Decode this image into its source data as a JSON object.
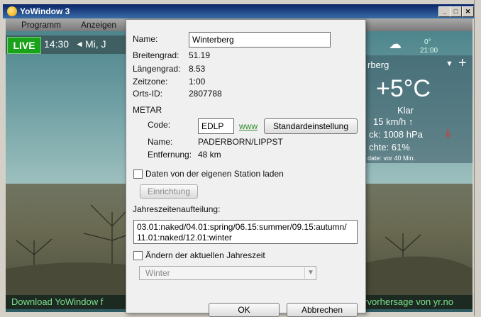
{
  "window": {
    "title": "YoWindow 3",
    "min_label": "_",
    "max_label": "□",
    "close_label": "✕"
  },
  "menu": {
    "items": [
      "Programm",
      "Anzeigen"
    ]
  },
  "app": {
    "live_label": "LIVE",
    "time": "14:30",
    "nav_prev": "◄",
    "date_partial": "Mi, J",
    "forecast_time": "21:00",
    "forecast_temp": "0°",
    "location_partial": "rberg",
    "temperature": "+5°C",
    "condition": "Klar",
    "wind": "15 km/h ↑",
    "pressure": "ck:  1008 hPa",
    "humidity": "chte:  61%",
    "update": "date:  vor 40 Min.",
    "download_text": "Download YoWindow f",
    "credit_text": "ervorhersage von yr.no"
  },
  "dialog": {
    "name_label": "Name:",
    "name_value": "Winterberg",
    "lat_label": "Breitengrad:",
    "lat_value": "51.19",
    "lon_label": "Längengrad:",
    "lon_value": "8.53",
    "tz_label": "Zeitzone:",
    "tz_value": "1:00",
    "id_label": "Orts-ID:",
    "id_value": "2807788",
    "metar_heading": "METAR",
    "code_label": "Code:",
    "code_value": "EDLP",
    "www_link": "www",
    "default_button": "Standardeinstellung",
    "station_name_label": "Name:",
    "station_name_value": "PADERBORN/LIPPST",
    "distance_label": "Entfernung:",
    "distance_value": "48 km",
    "own_station_label": "Daten von der eigenen Station laden",
    "setup_button": "Einrichtung",
    "season_label": "Jahreszeitenaufteilung:",
    "season_value": "03.01:naked/04.01:spring/06.15:summer/09.15:autumn/\n11.01:naked/12.01:winter",
    "change_season_label": "Ändern der aktuellen Jahreszeit",
    "season_select_value": "Winter",
    "ok_button": "OK",
    "cancel_button": "Abbrechen"
  }
}
